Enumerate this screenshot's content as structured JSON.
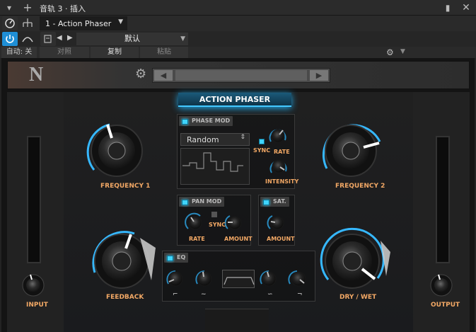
{
  "window": {
    "title": "音轨 3 · 插入"
  },
  "toolbar": {
    "plugin_name": "1 - Action Phaser",
    "preset_label": "默认",
    "auto_label": "自动: 关",
    "compare_label": "对照",
    "copy_label": "复制",
    "paste_label": "粘贴"
  },
  "plugin": {
    "title": "ACTION PHASER",
    "logo": "N",
    "sections": {
      "phase_mod": "PHASE MOD",
      "pan_mod": "PAN MOD",
      "sat": "SAT.",
      "eq": "EQ"
    },
    "phase_mod_mode": "Random",
    "knob_labels": {
      "frequency1": "FREQUENCY 1",
      "frequency2": "FREQUENCY 2",
      "feedback": "FEEDBACK",
      "drywet": "DRY / WET",
      "input": "INPUT",
      "output": "OUTPUT",
      "rate": "RATE",
      "intensity": "INTENSITY",
      "sync": "SYNC",
      "pan_rate": "RATE",
      "pan_sync": "SYNC",
      "pan_amount": "AMOUNT",
      "sat_amount": "AMOUNT"
    },
    "accent_color": "#3fd4ff",
    "label_color": "#f2a865"
  },
  "icons": [
    "menu-arrow-icon",
    "plus-icon",
    "pin-icon",
    "close-icon",
    "power-icon",
    "routing-icon",
    "gear-icon",
    "prev-icon",
    "next-icon"
  ]
}
